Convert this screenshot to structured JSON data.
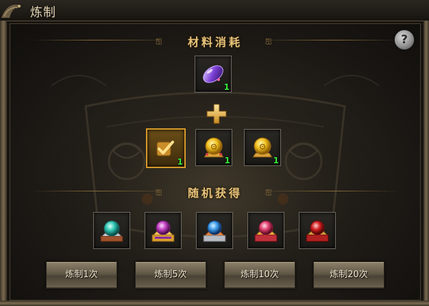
{
  "window": {
    "title": "炼制"
  },
  "sections": {
    "materials_title": "材料消耗",
    "rewards_title": "随机获得"
  },
  "help": {
    "label": "?"
  },
  "materials": {
    "top_item": {
      "icon": "purple-crystal-icon",
      "count": "1"
    },
    "slots": [
      {
        "icon": "checkmark-icon",
        "count": "1",
        "selected": true
      },
      {
        "icon": "golden-orb-icon",
        "count": "1",
        "selected": false
      },
      {
        "icon": "golden-orb-icon",
        "count": "1",
        "selected": false
      }
    ]
  },
  "rewards": [
    {
      "icon": "cyan-orb-chest-icon"
    },
    {
      "icon": "purple-gem-chest-icon"
    },
    {
      "icon": "blue-gem-chest-icon"
    },
    {
      "icon": "pink-gem-chest-icon"
    },
    {
      "icon": "red-gem-chest-icon"
    }
  ],
  "buttons": [
    {
      "label": "炼制1次"
    },
    {
      "label": "炼制5次"
    },
    {
      "label": "炼制10次"
    },
    {
      "label": "炼制20次"
    }
  ],
  "colors": {
    "accent_gold": "#e8c37a",
    "count_green": "#38e83a",
    "selected_border": "#d79a2a"
  }
}
